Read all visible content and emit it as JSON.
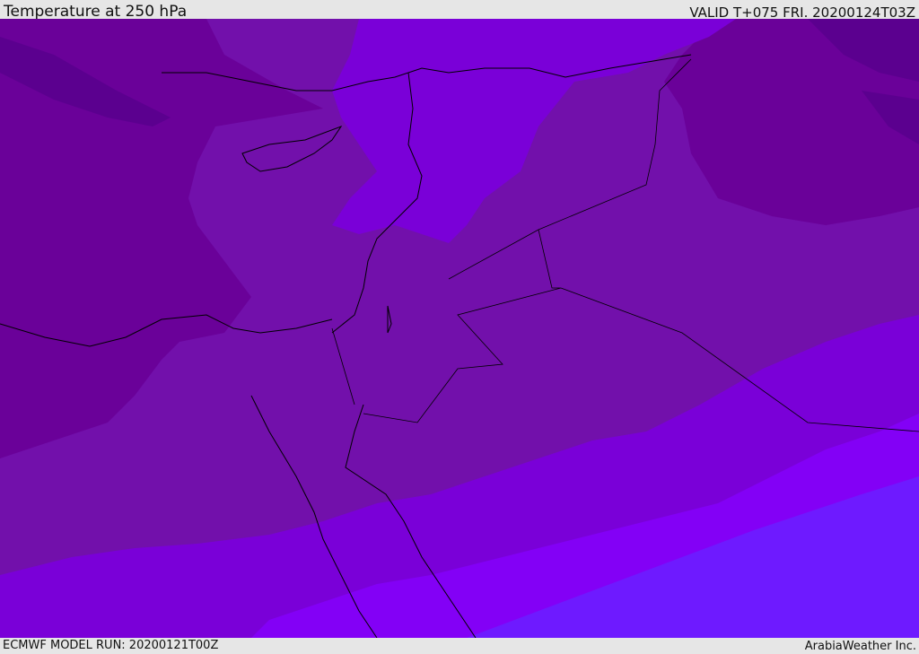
{
  "header": {
    "title": "Temperature at 250 hPa",
    "valid_time": "VALID T+075 FRI. 20200124T03Z"
  },
  "footer": {
    "model_run": "ECMWF MODEL RUN: 20200121T00Z",
    "credit": "ArabiaWeather Inc."
  },
  "map": {
    "field": "Temperature at 250 hPa",
    "colors": {
      "darkest": "#5b008f",
      "dark": "#6a0199",
      "mid": "#7210ab",
      "light": "#7a00d8",
      "brighter": "#8300f6",
      "brightest": "#6e1aff",
      "coastline": "#000000"
    }
  }
}
